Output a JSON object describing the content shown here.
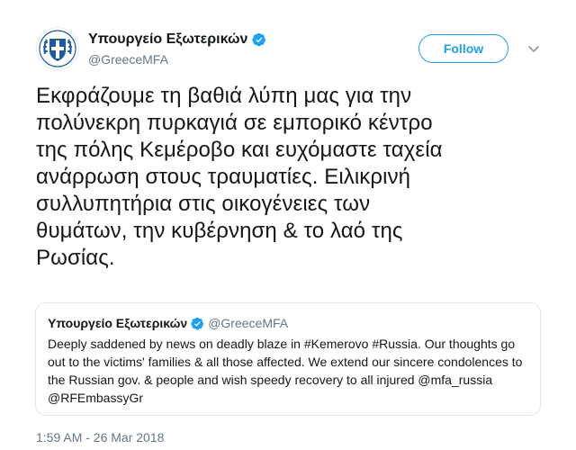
{
  "account": {
    "display_name": "Υπουργείο Εξωτερικών",
    "handle": "@GreeceMFA"
  },
  "follow_button": {
    "label": "Follow"
  },
  "tweet": {
    "text": "Εκφράζουμε τη βαθιά λύπη μας για την\nπολύνεκρη πυρκαγιά σε εμπορικό κέντρο\nτης πόλης Κεμέροβο και ευχόμαστε ταχεία\nανάρρωση στους τραυματίες. Ειλικρινή\nσυλλυπητήρια στις οικογένειες των\nθυμάτων, την κυβέρνηση & το λαό της\nΡωσίας.",
    "timestamp": "1:59 AM - 26 Mar 2018"
  },
  "quoted_tweet": {
    "display_name": "Υπουργείο Εξωτερικών",
    "handle": "@GreeceMFA",
    "text": "Deeply saddened by news on deadly blaze in #Kemerovo #Russia. Our thoughts go out to the victims' families & all those affected. We extend our sincere condolences to the Russian gov. & people and wish speedy recovery to all injured @mfa_russia @RFEmbassyGr"
  },
  "icons": {
    "avatar": "greek-coat-of-arms-icon",
    "verified": "verified-badge-icon",
    "caret": "chevron-down-icon"
  },
  "colors": {
    "accent": "#1da1f2",
    "text": "#14171a",
    "secondary_text": "#657786",
    "border": "#e1e8ed"
  }
}
